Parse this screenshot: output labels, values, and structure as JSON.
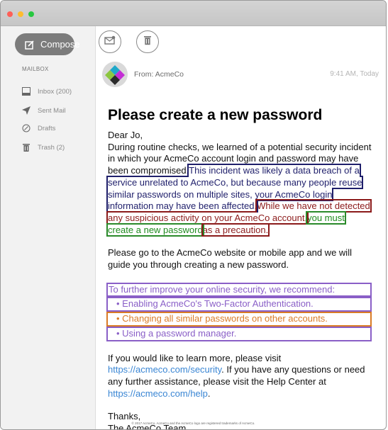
{
  "window": {
    "colors": {
      "close": "#fe5f57",
      "minimize": "#febc2e",
      "zoom": "#28c840"
    }
  },
  "sidebar": {
    "compose_label": "Compose",
    "mailbox_label": "MAILBOX",
    "items": [
      {
        "label": "Inbox (200)",
        "icon": "inbox-icon"
      },
      {
        "label": "Sent Mail",
        "icon": "send-icon"
      },
      {
        "label": "Drafts",
        "icon": "drafts-icon"
      },
      {
        "label": "Trash (2)",
        "icon": "trash-icon"
      }
    ]
  },
  "toolbar": {
    "buttons": [
      "mail-icon",
      "trash-icon"
    ]
  },
  "email": {
    "from": "From: AcmeCo",
    "time": "9:41 AM, Today",
    "subject": "Please create a new password",
    "greeting": "Dear Jo,",
    "p1_intro": "During routine checks, we learned of a potential security incident in which your AcmeCo account login and password may have been compromised.",
    "p1_breach": "This incident was likely a data breach of a service unrelated to AcmeCo, but because many people reuse similar passwords on multiple sites, your AcmeCo login information may have been affected.",
    "p1_no_activity": "While we have not detected any suspicious activity on your AcmeCo account,",
    "p1_must_change": "you must create a new password",
    "p1_precaution": "as a precaution.",
    "p2": "Please go to the AcmeCo website or mobile app and we will guide you through creating a new password.",
    "rec_intro": "To further improve your online security, we recommend:",
    "rec_items": [
      "• Enabling AcmeCo's Two-Factor Authentication.",
      "• Changing all similar passwords on other accounts.",
      "• Using a password manager."
    ],
    "p4_a": "If you would like to learn more, please visit ",
    "p4_link1": "https://acmeco.com/security",
    "p4_b": ". If you have any questions or need any further assistance, please visit the Help Center at ",
    "p4_link2": "https://acmeco.com/help",
    "p4_c": ".",
    "thanks": "Thanks,",
    "signature": "The AcmeCo Team",
    "footer": "© 2017 AcmeCo. AcmeCo and the AcmeCo logo are registered trademarks of AcmeCo."
  },
  "colors": {
    "navy": "#1f1f6b",
    "red": "#8b1a1a",
    "green": "#1d8a1d",
    "purple": "#8a5fc7",
    "orange": "#d97b26",
    "link": "#3a86d4"
  }
}
